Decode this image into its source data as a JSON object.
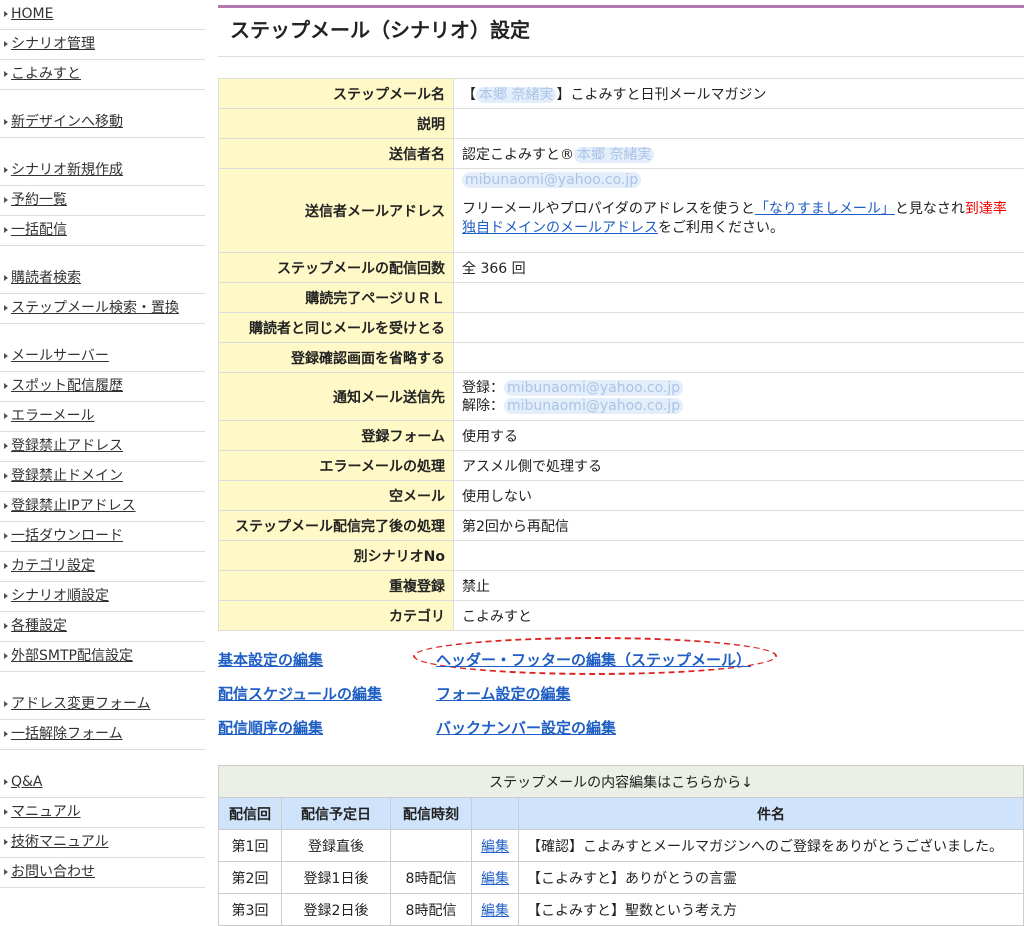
{
  "sidebar": {
    "groups": [
      [
        "HOME",
        "シナリオ管理",
        "こよみすと"
      ],
      [
        "新デザインへ移動"
      ],
      [
        "シナリオ新規作成",
        "予約一覧",
        "一括配信"
      ],
      [
        "購読者検索",
        "ステップメール検索・置換"
      ],
      [
        "メールサーバー",
        "スポット配信履歴",
        "エラーメール",
        "登録禁止アドレス",
        "登録禁止ドメイン",
        "登録禁止IPアドレス",
        "一括ダウンロード",
        "カテゴリ設定",
        "シナリオ順設定",
        "各種設定",
        "外部SMTP配信設定"
      ],
      [
        "アドレス変更フォーム",
        "一括解除フォーム"
      ],
      [
        "Q&A",
        "マニュアル",
        "技術マニュアル",
        "お問い合わせ"
      ]
    ]
  },
  "page": {
    "title": "ステップメール（シナリオ）設定"
  },
  "settings": {
    "stepmail_name_label": "ステップメール名",
    "stepmail_name_prefix": "【",
    "stepmail_name_blurred": "本郷 奈緒実",
    "stepmail_name_suffix": "】こよみすと日刊メールマガジン",
    "description_label": "説明",
    "sender_name_label": "送信者名",
    "sender_name_prefix": "認定こよみすと®",
    "sender_name_blurred": "本郷 奈緒実",
    "sender_address_label": "送信者メールアドレス",
    "sender_address_blurred": "mibunaomi@yahoo.co.jp",
    "sender_note_1": "フリーメールやプロパイダのアドレスを使うと",
    "sender_note_link": "「なりすましメール」",
    "sender_note_2": "と見なされ",
    "sender_note_red": "到達率",
    "sender_note_link2": "独自ドメインのメールアドレス",
    "sender_note_3": "をご利用ください。",
    "delivery_count_label": "ステップメールの配信回数",
    "delivery_count_value": "全 366 回",
    "complete_url_label": "購読完了ページＵＲＬ",
    "same_mail_label": "購読者と同じメールを受けとる",
    "skip_confirm_label": "登録確認画面を省略する",
    "notify_label": "通知メール送信先",
    "notify_register_label": "登録：",
    "notify_register_blurred": "mibunaomi@yahoo.co.jp",
    "notify_cancel_label": "解除：",
    "notify_cancel_blurred": "mibunaomi@yahoo.co.jp",
    "form_label": "登録フォーム",
    "form_value": "使用する",
    "error_label": "エラーメールの処理",
    "error_value": "アスメル側で処理する",
    "empty_label": "空メール",
    "empty_value": "使用しない",
    "after_label": "ステップメール配信完了後の処理",
    "after_value": "第2回から再配信",
    "other_label": "別シナリオNo",
    "dup_label": "重複登録",
    "dup_value": "禁止",
    "category_label": "カテゴリ",
    "category_value": "こよみすと"
  },
  "links": {
    "basic": "基本設定の編集",
    "header_footer": "ヘッダー・フッターの編集（ステップメール）",
    "schedule": "配信スケジュールの編集",
    "form": "フォーム設定の編集",
    "order": "配信順序の編集",
    "backnumber": "バックナンバー設定の編集"
  },
  "steps": {
    "notice": "ステップメールの内容編集はこちらから↓",
    "headers": [
      "配信回",
      "配信予定日",
      "配信時刻",
      "",
      "件名"
    ],
    "rows": [
      {
        "no": "第1回",
        "date": "登録直後",
        "time": "",
        "edit": "編集",
        "subject": "【確認】こよみすとメールマガジンへのご登録をありがとうございました。"
      },
      {
        "no": "第2回",
        "date": "登録1日後",
        "time": "8時配信",
        "edit": "編集",
        "subject": "【こよみすと】ありがとうの言霊"
      },
      {
        "no": "第3回",
        "date": "登録2日後",
        "time": "8時配信",
        "edit": "編集",
        "subject": "【こよみすと】聖数という考え方"
      }
    ]
  }
}
